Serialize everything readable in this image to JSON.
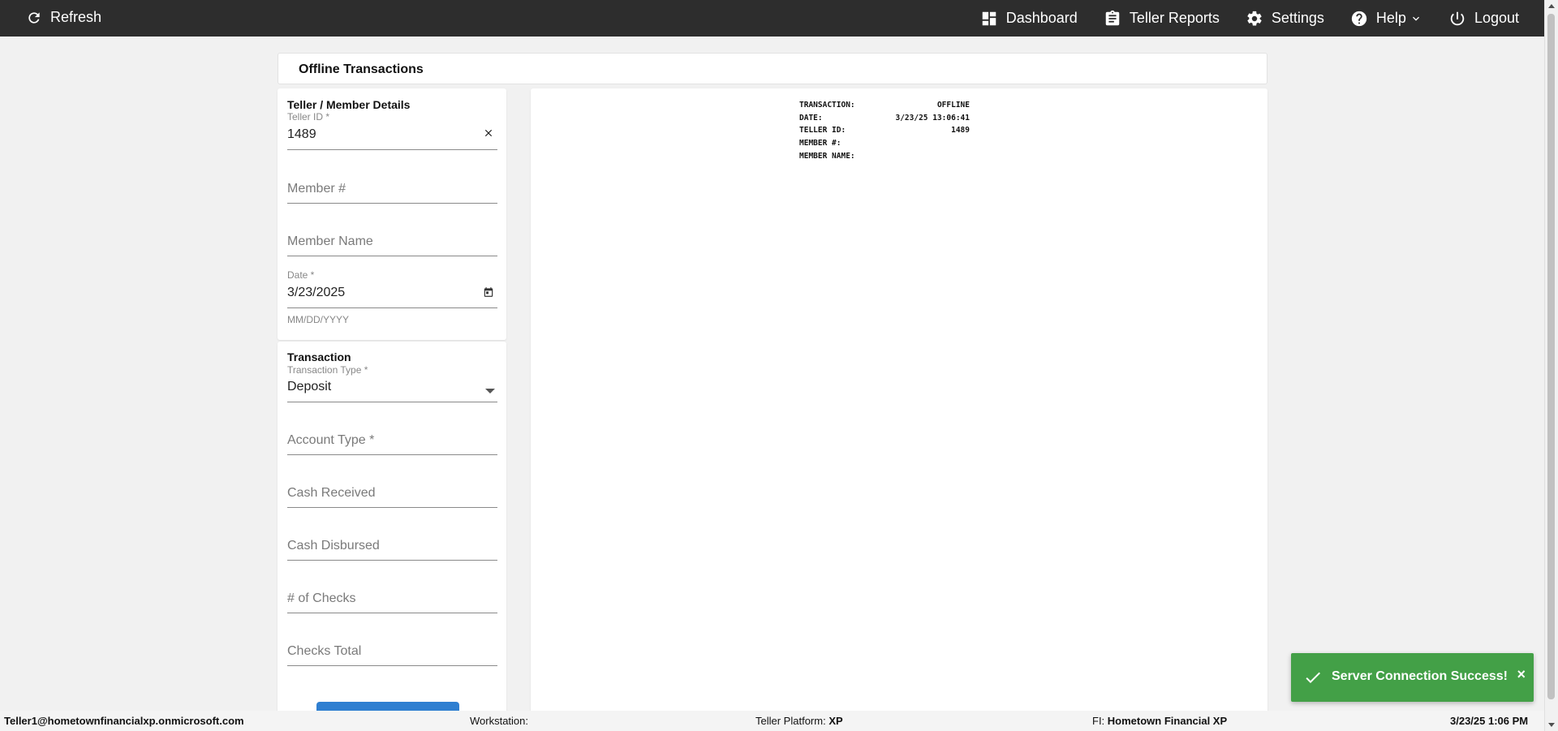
{
  "topbar": {
    "refresh_label": "Refresh",
    "nav": {
      "dashboard": "Dashboard",
      "teller_reports": "Teller Reports",
      "settings": "Settings",
      "help": "Help",
      "logout": "Logout"
    }
  },
  "page": {
    "title": "Offline Transactions"
  },
  "details": {
    "section_title": "Teller / Member Details",
    "teller_id_label": "Teller ID *",
    "teller_id_value": "1489",
    "member_number_placeholder": "Member #",
    "member_name_placeholder": "Member Name",
    "date_label": "Date *",
    "date_value": "3/23/2025",
    "date_helper": "MM/DD/YYYY"
  },
  "transaction": {
    "section_title": "Transaction",
    "type_label": "Transaction Type *",
    "type_value": "Deposit",
    "account_type_placeholder": "Account Type *",
    "cash_received_placeholder": "Cash Received",
    "cash_disbursed_placeholder": "Cash Disbursed",
    "num_checks_placeholder": "# of Checks",
    "checks_total_placeholder": "Checks Total"
  },
  "receipt": {
    "lines": [
      {
        "label": "TRANSACTION:",
        "value": "OFFLINE"
      },
      {
        "label": "DATE:",
        "value": "3/23/25 13:06:41"
      },
      {
        "label": "TELLER ID:",
        "value": "1489"
      },
      {
        "label": "MEMBER #:",
        "value": ""
      },
      {
        "label": "MEMBER NAME:",
        "value": ""
      }
    ]
  },
  "statusbar": {
    "user": "Teller1@hometownfinancialxp.onmicrosoft.com",
    "workstation_label": "Workstation:",
    "platform_label": "Teller Platform:",
    "platform_value": "XP",
    "fi_label": "FI:",
    "fi_value": "Hometown Financial XP",
    "datetime": "3/23/25 1:06 PM"
  },
  "toast": {
    "message": "Server Connection Success!",
    "close": "×"
  },
  "colors": {
    "topbar": "#2d2d2d",
    "toast": "#43a047",
    "primary_button": "#2f7fd1"
  }
}
